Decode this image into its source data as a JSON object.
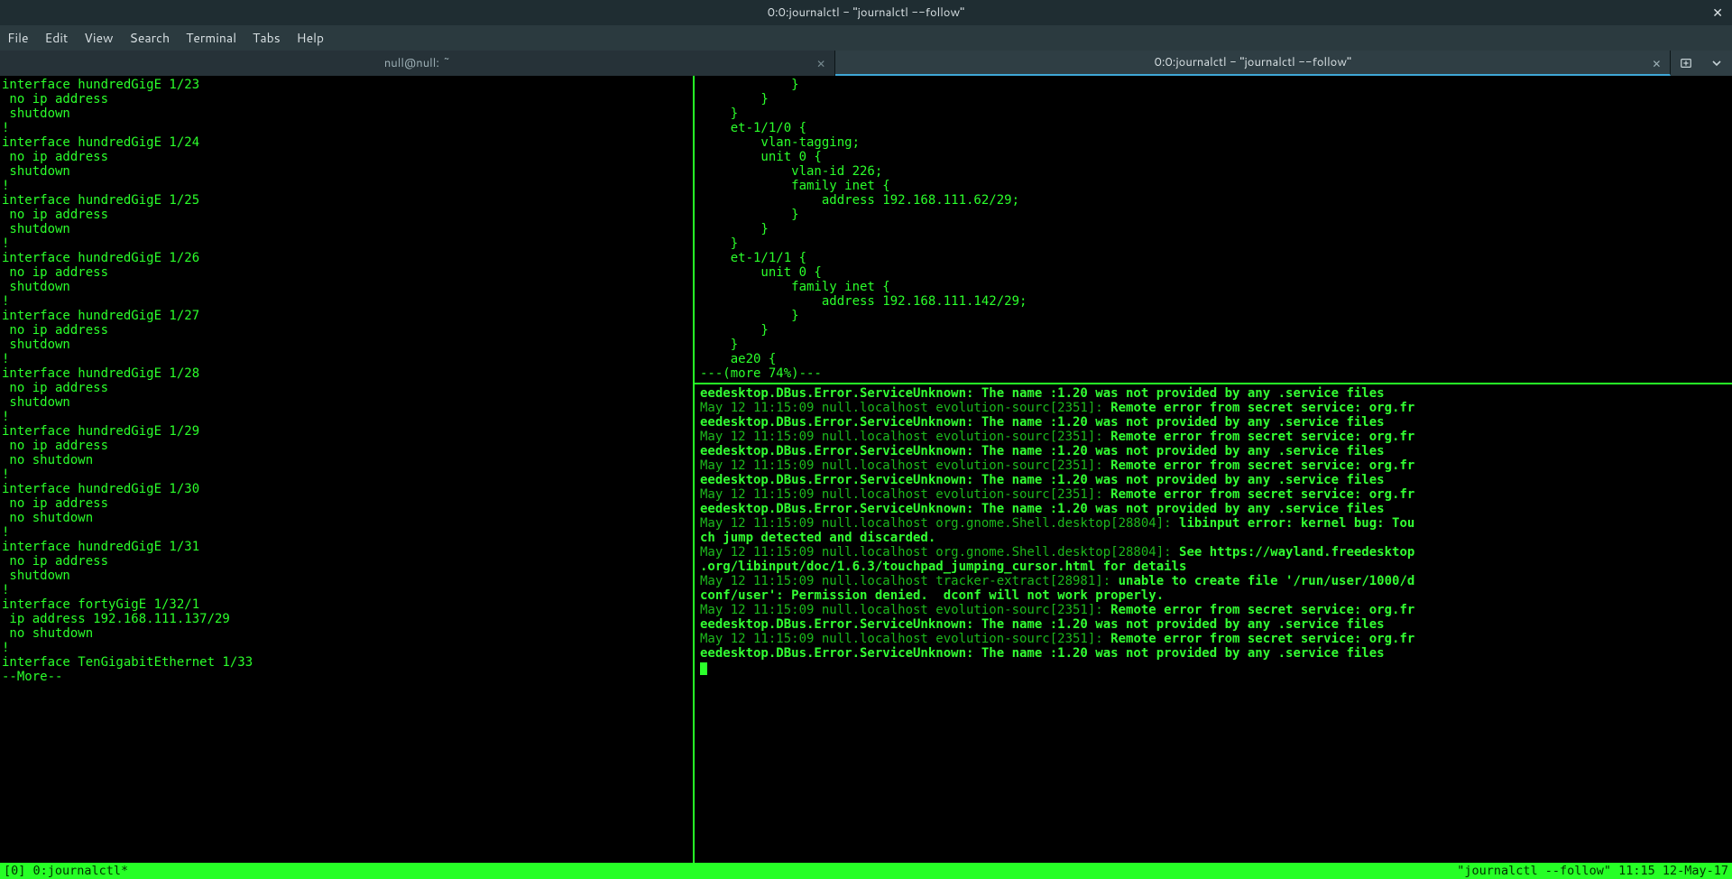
{
  "titlebar": {
    "text": "0:0:journalctl - \"journalctl --follow\""
  },
  "menubar": {
    "items": [
      "File",
      "Edit",
      "View",
      "Search",
      "Terminal",
      "Tabs",
      "Help"
    ]
  },
  "tabs": [
    {
      "label": "null@null: ~",
      "active": false
    },
    {
      "label": "0:0:journalctl - \"journalctl --follow\"",
      "active": true
    }
  ],
  "left_pane": {
    "lines": [
      "interface hundredGigE 1/23",
      " no ip address",
      " shutdown",
      "!",
      "interface hundredGigE 1/24",
      " no ip address",
      " shutdown",
      "!",
      "interface hundredGigE 1/25",
      " no ip address",
      " shutdown",
      "!",
      "interface hundredGigE 1/26",
      " no ip address",
      " shutdown",
      "!",
      "interface hundredGigE 1/27",
      " no ip address",
      " shutdown",
      "!",
      "interface hundredGigE 1/28",
      " no ip address",
      " shutdown",
      "!",
      "interface hundredGigE 1/29",
      " no ip address",
      " no shutdown",
      "!",
      "interface hundredGigE 1/30",
      " no ip address",
      " no shutdown",
      "!",
      "interface hundredGigE 1/31",
      " no ip address",
      " shutdown",
      "!",
      "interface fortyGigE 1/32/1",
      " ip address 192.168.111.137/29",
      " no shutdown",
      "!",
      "interface TenGigabitEthernet 1/33",
      "--More--"
    ]
  },
  "right_top": {
    "lines": [
      "            }",
      "        }",
      "    }",
      "    et-1/1/0 {",
      "        vlan-tagging;",
      "        unit 0 {",
      "            vlan-id 226;",
      "            family inet {",
      "                address 192.168.111.62/29;",
      "            }",
      "        }",
      "    }",
      "    et-1/1/1 {",
      "        unit 0 {",
      "            family inet {",
      "                address 192.168.111.142/29;",
      "            }",
      "        }",
      "    }",
      "    ae20 {",
      "---(more 74%)---"
    ]
  },
  "right_bottom": {
    "entries": [
      {
        "prefix": "",
        "bold": "eedesktop.DBus.Error.ServiceUnknown: The name :1.20 was not provided by any .service files"
      },
      {
        "prefix": "May 12 11:15:09 null.localhost evolution-sourc[2351]: ",
        "bold": "Remote error from secret service: org.fr"
      },
      {
        "prefix": "",
        "bold": "eedesktop.DBus.Error.ServiceUnknown: The name :1.20 was not provided by any .service files"
      },
      {
        "prefix": "May 12 11:15:09 null.localhost evolution-sourc[2351]: ",
        "bold": "Remote error from secret service: org.fr"
      },
      {
        "prefix": "",
        "bold": "eedesktop.DBus.Error.ServiceUnknown: The name :1.20 was not provided by any .service files"
      },
      {
        "prefix": "May 12 11:15:09 null.localhost evolution-sourc[2351]: ",
        "bold": "Remote error from secret service: org.fr"
      },
      {
        "prefix": "",
        "bold": "eedesktop.DBus.Error.ServiceUnknown: The name :1.20 was not provided by any .service files"
      },
      {
        "prefix": "May 12 11:15:09 null.localhost evolution-sourc[2351]: ",
        "bold": "Remote error from secret service: org.fr"
      },
      {
        "prefix": "",
        "bold": "eedesktop.DBus.Error.ServiceUnknown: The name :1.20 was not provided by any .service files"
      },
      {
        "prefix": "May 12 11:15:09 null.localhost org.gnome.Shell.desktop[28804]: ",
        "bold": "libinput error: kernel bug: Tou"
      },
      {
        "prefix": "",
        "bold": "ch jump detected and discarded."
      },
      {
        "prefix": "May 12 11:15:09 null.localhost org.gnome.Shell.desktop[28804]: ",
        "bold": "See https://wayland.freedesktop"
      },
      {
        "prefix": "",
        "bold": ".org/libinput/doc/1.6.3/touchpad_jumping_cursor.html for details"
      },
      {
        "prefix": "May 12 11:15:09 null.localhost tracker-extract[28981]: ",
        "bold": "unable to create file '/run/user/1000/d"
      },
      {
        "prefix": "",
        "bold": "conf/user': Permission denied.  dconf will not work properly."
      },
      {
        "prefix": "May 12 11:15:09 null.localhost evolution-sourc[2351]: ",
        "bold": "Remote error from secret service: org.fr"
      },
      {
        "prefix": "",
        "bold": "eedesktop.DBus.Error.ServiceUnknown: The name :1.20 was not provided by any .service files"
      },
      {
        "prefix": "May 12 11:15:09 null.localhost evolution-sourc[2351]: ",
        "bold": "Remote error from secret service: org.fr"
      },
      {
        "prefix": "",
        "bold": "eedesktop.DBus.Error.ServiceUnknown: The name :1.20 was not provided by any .service files"
      }
    ]
  },
  "tmux": {
    "left": "[0] 0:journalctl*",
    "right": "\"journalctl --follow\" 11:15 12-May-17"
  }
}
